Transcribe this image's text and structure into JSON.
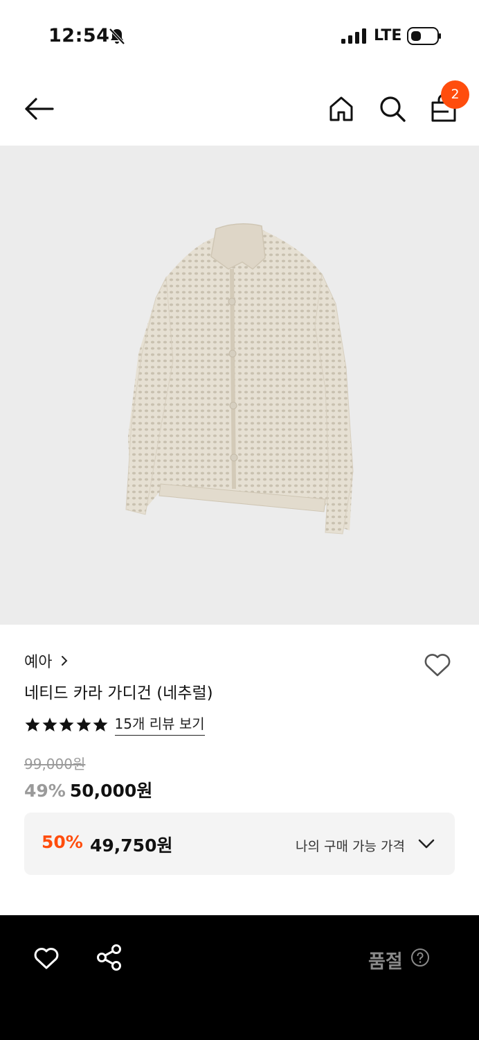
{
  "status_bar": {
    "time": "12:54",
    "network": "LTE",
    "icons": [
      "bell-muted-icon",
      "signal-icon",
      "battery-icon"
    ]
  },
  "header": {
    "icons": [
      "back-arrow-icon",
      "home-icon",
      "search-icon",
      "shopping-bag-icon"
    ],
    "cart_count": "2",
    "badge_color": "#ff4d0d"
  },
  "product": {
    "image_background": "#ececec",
    "brand": "예아",
    "name": "네티드 카라 가디건 (네추럴)",
    "rating_stars": 5,
    "review_link": "15개 리뷰 보기",
    "original_price": "99,000원",
    "discount_rate": "49%",
    "sale_price": "50,000원"
  },
  "my_price": {
    "discount_rate": "50%",
    "price": "49,750원",
    "label": "나의 구매 가능 가격",
    "accent_color": "#ff4d0d"
  },
  "bottom_bar": {
    "soldout_label": "품절",
    "icons": [
      "heart-outline-icon",
      "share-icon",
      "help-circle-icon"
    ]
  }
}
